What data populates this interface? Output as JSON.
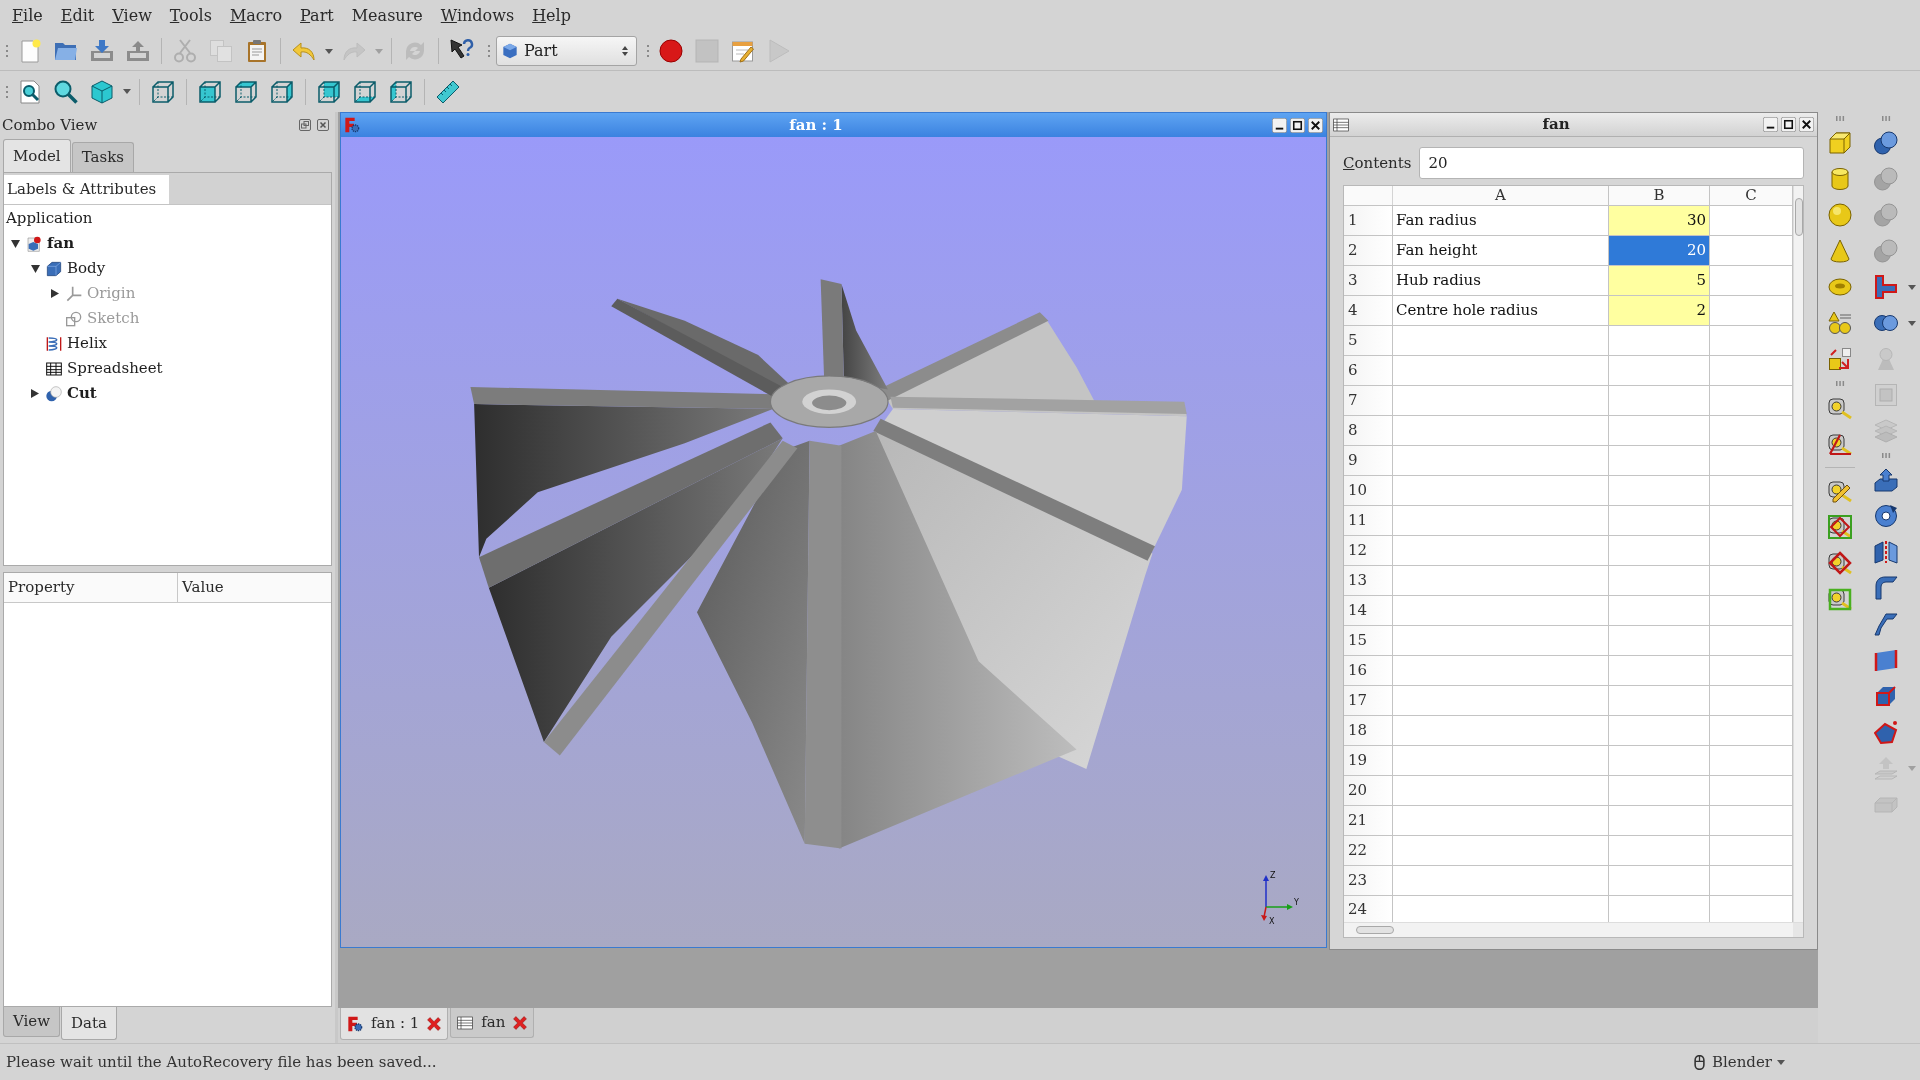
{
  "menu_bar": [
    {
      "label": "File",
      "mnemonic": true
    },
    {
      "label": "Edit",
      "mnemonic": true
    },
    {
      "label": "View",
      "mnemonic": true
    },
    {
      "label": "Tools",
      "mnemonic": true
    },
    {
      "label": "Macro",
      "mnemonic": true
    },
    {
      "label": "Part",
      "mnemonic": true
    },
    {
      "label": "Measure",
      "mnemonic": false
    },
    {
      "label": "Windows",
      "mnemonic": true
    },
    {
      "label": "Help",
      "mnemonic": true
    }
  ],
  "toolbar_row_1": [
    {
      "groups": [
        [
          {
            "kind": "new",
            "disabled": false
          },
          {
            "kind": "open",
            "disabled": false
          },
          {
            "kind": "save",
            "disabled": false
          },
          {
            "kind": "export",
            "disabled": false
          }
        ],
        [
          {
            "kind": "cut",
            "disabled": true
          },
          {
            "kind": "copy",
            "disabled": true
          },
          {
            "kind": "paste",
            "disabled": false
          }
        ],
        [
          {
            "kind": "undo",
            "disabled": false,
            "dropdown": true
          },
          {
            "kind": "redo",
            "disabled": true,
            "dropdown": true
          }
        ],
        [
          {
            "kind": "refresh",
            "disabled": true
          }
        ],
        [
          {
            "kind": "whatsthis",
            "disabled": false
          }
        ]
      ]
    },
    {
      "groups": [
        [
          {
            "kind": "workbench",
            "label": "Part"
          }
        ]
      ]
    },
    {
      "groups": [
        [
          {
            "kind": "record",
            "disabled": false
          },
          {
            "kind": "stop",
            "disabled": true
          },
          {
            "kind": "macro",
            "disabled": false
          },
          {
            "kind": "play",
            "disabled": true
          }
        ]
      ]
    }
  ],
  "toolbar_row_2": [
    {
      "groups": [
        [
          {
            "kind": "fitall",
            "disabled": false
          },
          {
            "kind": "fitselection",
            "disabled": false
          },
          {
            "kind": "drawstyle",
            "disabled": false,
            "dropdown": true
          }
        ],
        [
          {
            "kind": "isometric",
            "disabled": false
          }
        ],
        [
          {
            "kind": "front",
            "disabled": false
          },
          {
            "kind": "top",
            "disabled": false
          },
          {
            "kind": "right",
            "disabled": false
          }
        ],
        [
          {
            "kind": "rear",
            "disabled": false
          },
          {
            "kind": "bottom",
            "disabled": false
          },
          {
            "kind": "left",
            "disabled": false
          }
        ],
        [
          {
            "kind": "ruler",
            "disabled": false
          }
        ]
      ]
    }
  ],
  "combo_view": {
    "title": "Combo View",
    "tabs": [
      {
        "label": "Model",
        "selected": true
      },
      {
        "label": "Tasks",
        "selected": false
      }
    ],
    "tree": {
      "header": "Labels & Attributes",
      "root": {
        "label": "Application",
        "children": [
          {
            "label": "fan",
            "kind": "document",
            "bold": true,
            "hidden": false,
            "expanded": true,
            "children": [
              {
                "label": "Body",
                "kind": "body",
                "bold": false,
                "hidden": false,
                "expanded": true,
                "children": [
                  {
                    "label": "Origin",
                    "kind": "origin",
                    "bold": false,
                    "hidden": true,
                    "expanded": false
                  },
                  {
                    "label": "Sketch",
                    "kind": "sketch",
                    "bold": false,
                    "hidden": true
                  }
                ]
              },
              {
                "label": "Helix",
                "kind": "helix",
                "bold": false,
                "hidden": false
              },
              {
                "label": "Spreadsheet",
                "kind": "sheet",
                "bold": false,
                "hidden": false
              },
              {
                "label": "Cut",
                "kind": "booleancut",
                "bold": true,
                "hidden": false,
                "expanded": false
              }
            ]
          }
        ]
      }
    },
    "property_view": {
      "columns": [
        "Property",
        "Value"
      ],
      "tabs": [
        {
          "label": "View",
          "selected": false
        },
        {
          "label": "Data",
          "selected": true
        }
      ]
    }
  },
  "view_3d_window": {
    "title": "fan : 1",
    "active": true,
    "axis_labels": [
      "Z",
      "Y",
      "X"
    ]
  },
  "spreadsheet_window": {
    "title": "fan",
    "active": false,
    "contents": {
      "label": "Contents",
      "mnemonic": true,
      "value": "20"
    },
    "columns": [
      "A",
      "B",
      "C"
    ],
    "rows": [
      {
        "number": "1",
        "cells": [
          {
            "text": "Fan radius",
            "selected": false
          },
          {
            "text": "30",
            "selected": false,
            "color": "#ffffa0"
          },
          {
            "selected": false
          }
        ]
      },
      {
        "number": "2",
        "cells": [
          {
            "text": "Fan height",
            "selected": false
          },
          {
            "text": "20",
            "selected": true
          },
          {
            "selected": false
          }
        ]
      },
      {
        "number": "3",
        "cells": [
          {
            "text": "Hub radius",
            "selected": false
          },
          {
            "text": "5",
            "selected": false,
            "color": "#ffffa0"
          },
          {
            "selected": false
          }
        ]
      },
      {
        "number": "4",
        "cells": [
          {
            "text": "Centre hole radius",
            "selected": false
          },
          {
            "text": "2",
            "selected": false,
            "color": "#ffffa0"
          },
          {
            "selected": false
          }
        ]
      },
      {
        "number": "5"
      },
      {
        "number": "6"
      },
      {
        "number": "7"
      },
      {
        "number": "8"
      },
      {
        "number": "9"
      },
      {
        "number": "10"
      },
      {
        "number": "11"
      },
      {
        "number": "12"
      },
      {
        "number": "13"
      },
      {
        "number": "14"
      },
      {
        "number": "15"
      },
      {
        "number": "16"
      },
      {
        "number": "17"
      },
      {
        "number": "18"
      },
      {
        "number": "19"
      },
      {
        "number": "20"
      },
      {
        "number": "21"
      },
      {
        "number": "22"
      },
      {
        "number": "23"
      },
      {
        "number": "24"
      }
    ]
  },
  "document_tabs": [
    {
      "label": "fan : 1",
      "kind": "view3d",
      "selected": true
    },
    {
      "label": "fan",
      "kind": "spreadsheet",
      "selected": false
    }
  ],
  "side_toolbar": {
    "columns": [
      [
        {
          "groups": [
            [
              {
                "kind": "box",
                "disabled": false
              },
              {
                "kind": "cylinder",
                "disabled": false
              },
              {
                "kind": "sphere",
                "disabled": false
              },
              {
                "kind": "cone",
                "disabled": false
              },
              {
                "kind": "torus",
                "disabled": false
              },
              {
                "kind": "primitives",
                "disabled": false
              },
              {
                "kind": "shapebuilder",
                "disabled": false
              }
            ]
          ]
        },
        {
          "groups": [
            [
              {
                "kind": "measurelinear",
                "disabled": false
              },
              {
                "kind": "measureangular",
                "disabled": false
              }
            ],
            [
              {
                "kind": "measurerefresh",
                "disabled": false
              },
              {
                "kind": "measureclear",
                "disabled": false
              },
              {
                "kind": "measuretoggle",
                "disabled": false
              },
              {
                "kind": "measuredelta",
                "disabled": false
              }
            ]
          ]
        }
      ],
      [
        {
          "groups": [
            [
              {
                "kind": "boolean",
                "disabled": false
              },
              {
                "kind": "cutshapes",
                "disabled": true
              },
              {
                "kind": "fuse",
                "disabled": true
              },
              {
                "kind": "common",
                "disabled": true
              },
              {
                "kind": "join",
                "disabled": false,
                "dropdown": true
              },
              {
                "kind": "split",
                "disabled": false,
                "dropdown": true
              },
              {
                "kind": "section",
                "disabled": true
              },
              {
                "kind": "crosssections",
                "disabled": true
              },
              {
                "kind": "compound",
                "disabled": true
              }
            ]
          ]
        },
        {
          "groups": [
            [
              {
                "kind": "extrude",
                "disabled": false
              },
              {
                "kind": "revolve",
                "disabled": false
              },
              {
                "kind": "mirror",
                "disabled": false
              },
              {
                "kind": "fillet",
                "disabled": false
              },
              {
                "kind": "chamfer",
                "disabled": false
              },
              {
                "kind": "face",
                "disabled": false
              },
              {
                "kind": "ruled",
                "disabled": false
              },
              {
                "kind": "loft",
                "disabled": false
              },
              {
                "kind": "offset",
                "disabled": true,
                "dropdown": true
              },
              {
                "kind": "thickness",
                "disabled": true
              }
            ]
          ]
        }
      ]
    ]
  },
  "status_bar": {
    "message": "Please wait until the AutoRecovery file has been saved...",
    "navigation": "Blender"
  }
}
